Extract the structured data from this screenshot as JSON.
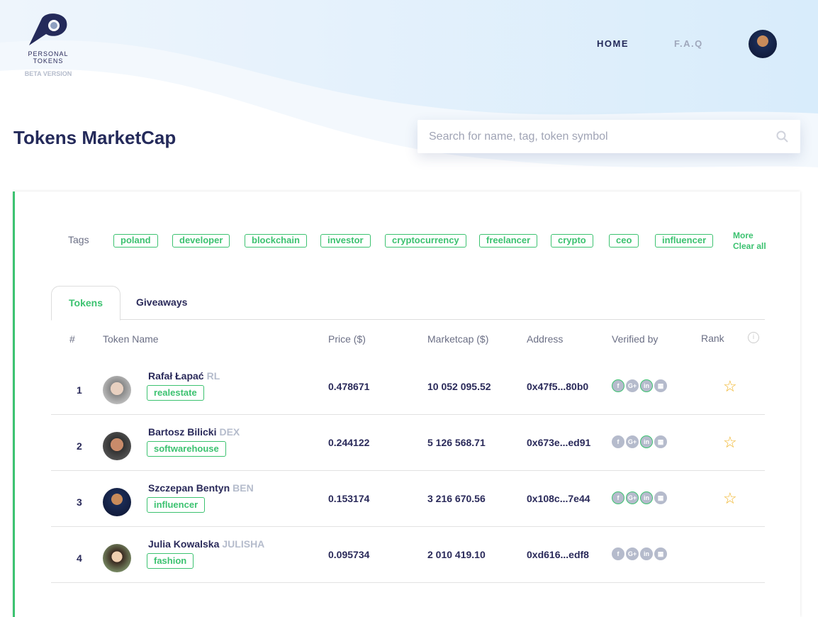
{
  "logo": {
    "name": "PERSONAL TOKENS",
    "beta": "BETA VERSION"
  },
  "nav": {
    "home": "HOME",
    "faq": "F.A.Q"
  },
  "page_title": "Tokens MarketCap",
  "search": {
    "placeholder": "Search for name, tag, token symbol",
    "value": ""
  },
  "tags": {
    "label": "Tags",
    "items": [
      "poland",
      "developer",
      "blockchain",
      "investor",
      "cryptocurrency",
      "freelancer",
      "crypto",
      "ceo",
      "influencer"
    ],
    "more": "More",
    "clear": "Clear all"
  },
  "tabs": [
    "Tokens",
    "Giveaways"
  ],
  "columns": [
    "#",
    "Token Name",
    "Price ($)",
    "Marketcap ($)",
    "Address",
    "Verified by",
    "Rank"
  ],
  "rows": [
    {
      "rank": "1",
      "name": "Rafał Łapać",
      "symbol": "RL",
      "tag": "realestate",
      "price": "0.478671",
      "marketcap": "10 052 095.52",
      "address": "0x47f5...80b0",
      "verified": [
        true,
        false,
        true,
        false
      ],
      "starred": true
    },
    {
      "rank": "2",
      "name": "Bartosz Bilicki",
      "symbol": "DEX",
      "tag": "softwarehouse",
      "price": "0.244122",
      "marketcap": "5 126 568.71",
      "address": "0x673e...ed91",
      "verified": [
        false,
        false,
        true,
        false
      ],
      "starred": true
    },
    {
      "rank": "3",
      "name": "Szczepan Bentyn",
      "symbol": "BEN",
      "tag": "influencer",
      "price": "0.153174",
      "marketcap": "3 216 670.56",
      "address": "0x108c...7e44",
      "verified": [
        true,
        true,
        true,
        false
      ],
      "starred": true
    },
    {
      "rank": "4",
      "name": "Julia Kowalska",
      "symbol": "JULISHA",
      "tag": "fashion",
      "price": "0.095734",
      "marketcap": "2 010 419.10",
      "address": "0xd616...edf8",
      "verified": [
        false,
        false,
        false,
        false
      ],
      "starred": false
    }
  ],
  "colors": {
    "accent": "#3cc270",
    "navy": "#242a5a",
    "star": "#f0b429"
  }
}
